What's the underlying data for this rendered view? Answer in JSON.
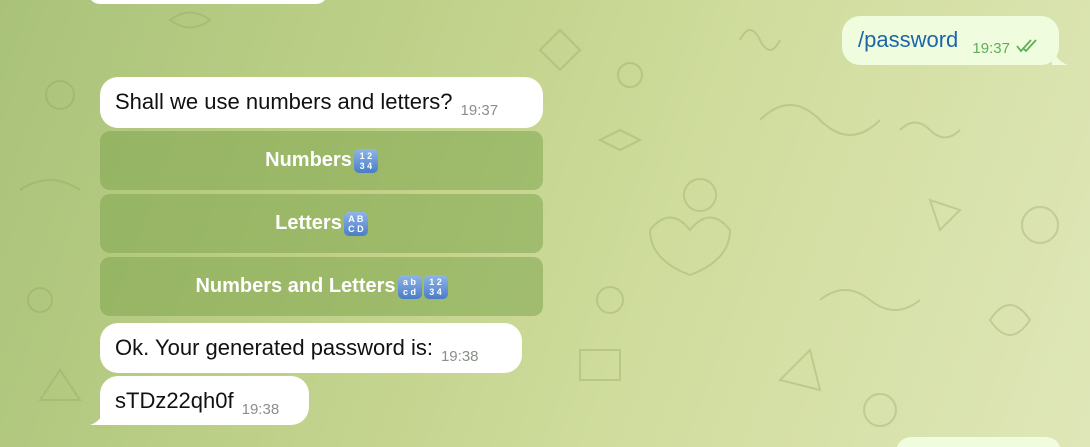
{
  "messages": {
    "outgoing_command": {
      "text": "/password",
      "time": "19:37"
    },
    "question": {
      "text": "Shall we use numbers and letters?",
      "time": "19:37"
    },
    "result": {
      "text": "Ok. Your generated password is:",
      "time": "19:38"
    },
    "password": {
      "text": "sTDz22qh0f",
      "time": "19:38"
    }
  },
  "keyboard": {
    "buttons": [
      {
        "label": "Numbers",
        "emoji": "input-numbers-icon"
      },
      {
        "label": "Letters",
        "emoji": "input-latin-uppercase-icon"
      },
      {
        "label": "Numbers and Letters",
        "emoji": "input-latin-lowercase-and-numbers-icon"
      }
    ]
  },
  "colors": {
    "incoming_bubble": "#ffffff",
    "outgoing_bubble": "#effdde",
    "button_bg": "#8ba85c",
    "read_check": "#5fae57"
  }
}
